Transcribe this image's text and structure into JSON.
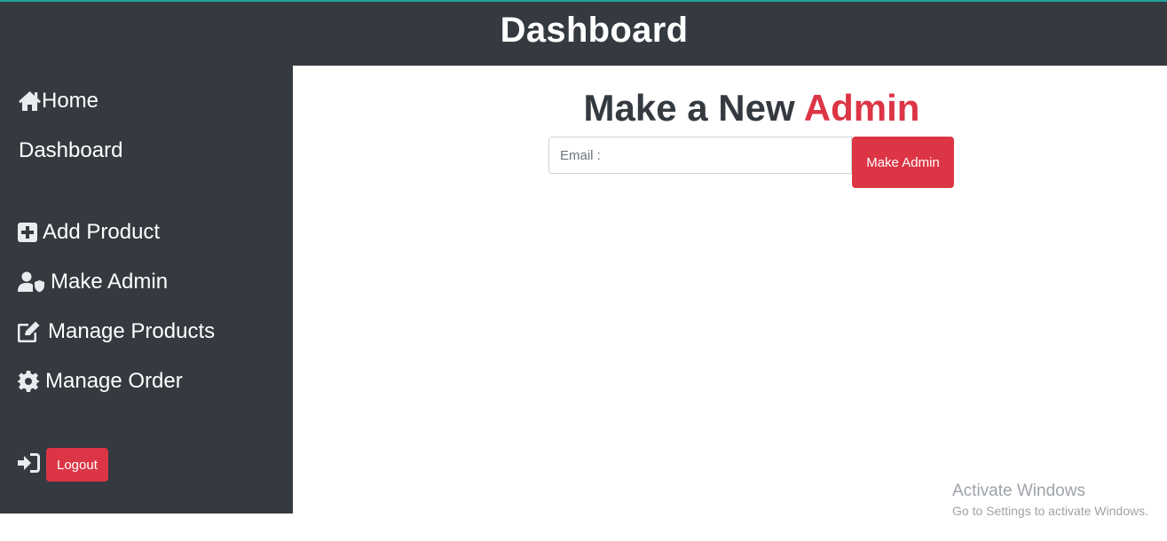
{
  "header": {
    "title": "Dashboard"
  },
  "sidebar": {
    "items": [
      {
        "label": "Home",
        "icon": "home-icon"
      },
      {
        "label": "Dashboard",
        "icon": ""
      },
      {
        "label": "Add Product",
        "icon": "plus-square-icon"
      },
      {
        "label": "Make Admin",
        "icon": "user-shield-icon"
      },
      {
        "label": "Manage Products",
        "icon": "edit-icon"
      },
      {
        "label": "Manage Order",
        "icon": "gear-icon"
      }
    ],
    "logout": {
      "label": "Logout",
      "icon": "sign-in-icon"
    }
  },
  "main": {
    "heading_prefix": "Make a New ",
    "heading_accent": "Admin",
    "email_placeholder": "Email :",
    "email_value": "",
    "submit_label": "Make Admin"
  },
  "watermark": {
    "title": "Activate Windows",
    "subtitle": "Go to Settings to activate Windows."
  },
  "colors": {
    "header_bg": "#343a40",
    "accent": "#dc3545",
    "top_border": "#20a39a"
  }
}
